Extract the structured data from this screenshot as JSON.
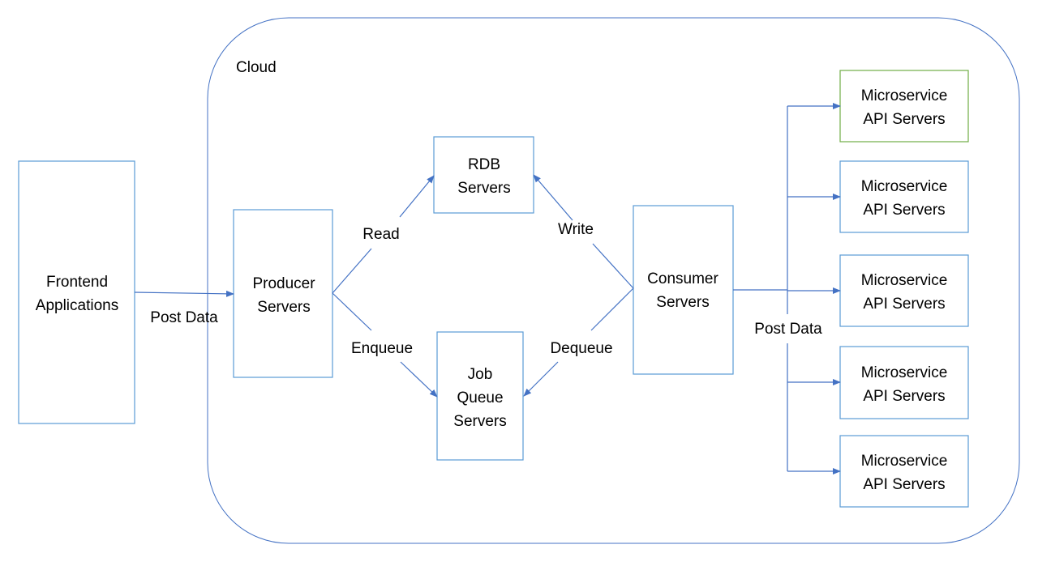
{
  "colors": {
    "box_border": "#5B9BD5",
    "highlight_border": "#70AD47",
    "line": "#4472C4"
  },
  "cloud": {
    "label": "Cloud"
  },
  "nodes": {
    "frontend": [
      "Frontend",
      "Applications"
    ],
    "producer": [
      "Producer",
      "Servers"
    ],
    "rdb": [
      "RDB",
      "Servers"
    ],
    "job_queue": [
      "Job",
      "Queue",
      "Servers"
    ],
    "consumer": [
      "Consumer",
      "Servers"
    ],
    "microservices": [
      [
        "Microservice",
        "API Servers"
      ],
      [
        "Microservice",
        "API Servers"
      ],
      [
        "Microservice",
        "API Servers"
      ],
      [
        "Microservice",
        "API Servers"
      ],
      [
        "Microservice",
        "API Servers"
      ]
    ]
  },
  "edges": {
    "frontend_post": "Post Data",
    "read": "Read",
    "enqueue": "Enqueue",
    "write": "Write",
    "dequeue": "Dequeue",
    "consumer_post": "Post Data"
  }
}
